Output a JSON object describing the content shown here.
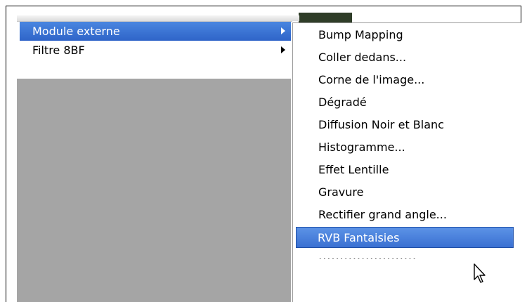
{
  "menu": {
    "items": [
      {
        "label": "Module externe",
        "selected": true,
        "has_submenu": true
      },
      {
        "label": "Filtre 8BF",
        "selected": false,
        "has_submenu": true
      }
    ]
  },
  "submenu": {
    "items": [
      {
        "label": "Bump Mapping"
      },
      {
        "label": "Coller dedans..."
      },
      {
        "label": "Corne de l'image..."
      },
      {
        "label": "Dégradé"
      },
      {
        "label": "Diffusion Noir et Blanc"
      },
      {
        "label": "Histogramme..."
      },
      {
        "label": "Effet Lentille"
      },
      {
        "label": "Gravure"
      },
      {
        "label": "Rectifier grand angle..."
      },
      {
        "label": "RVB Fantaisies",
        "selected": true
      }
    ]
  },
  "colors": {
    "selection": "#2f64c8",
    "background_panel": "#a5a5a5"
  },
  "icons": {
    "cursor": "arrow-cursor-icon",
    "submenu_arrow": "chevron-right-icon"
  }
}
